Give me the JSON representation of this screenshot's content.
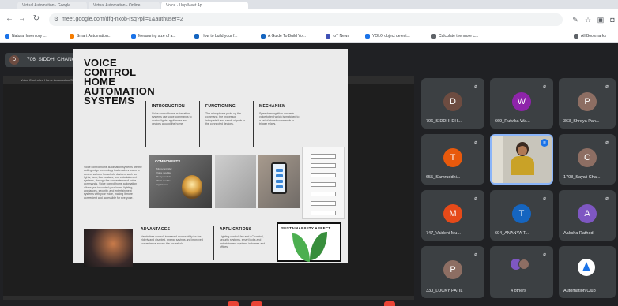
{
  "browser": {
    "tabs": [
      "Virtual Automation · Google...",
      "Virtual Automation - Online...",
      "Voice · Unp Meet Ap"
    ],
    "url": "meet.google.com/dfq-nxob-rsq?pli=1&authuser=2",
    "bookmarks": [
      {
        "label": "Natural Inventory ...",
        "color": "#1a73e8"
      },
      {
        "label": "Smart Automation...",
        "color": "#f57c00"
      },
      {
        "label": "Measuring size of a...",
        "color": "#1a73e8"
      },
      {
        "label": "How to build your f...",
        "color": "#1565c0"
      },
      {
        "label": "A Guide To Build Yo...",
        "color": "#1565c0"
      },
      {
        "label": "IoT News",
        "color": "#3f51b5"
      },
      {
        "label": "YOLO object detect...",
        "color": "#1a73e8"
      },
      {
        "label": "Calculate the more c...",
        "color": "#5f6368"
      },
      {
        "label": "All Bookmarks",
        "color": "#5f6368"
      }
    ]
  },
  "meet": {
    "presenter_initial": "D",
    "presenter_label": "706_SIDDHI CHANCHERE (Presenting)",
    "stage_title": "Voice Controlled Home Automation System · Poster Presentation",
    "participants": [
      {
        "name": "706_SIDDHI DH...",
        "initial": "D",
        "color": "#6d4c41"
      },
      {
        "name": "669_Rutvika Wa...",
        "initial": "W",
        "color": "#8e24aa"
      },
      {
        "name": "363_Shreya Pan...",
        "initial": "P",
        "color": "#8d6e63"
      },
      {
        "name": "655_Samruddhi...",
        "initial": "T",
        "color": "#e8590c"
      },
      {
        "name": "",
        "initial": "",
        "color": ""
      },
      {
        "name": "1708_Sayali Cha...",
        "initial": "C",
        "color": "#8d6e63"
      },
      {
        "name": "747_Vaidehi Mu...",
        "initial": "M",
        "color": "#e64a19"
      },
      {
        "name": "604_ANANYA T...",
        "initial": "T",
        "color": "#1565c0"
      },
      {
        "name": "Aaksha Rathod",
        "initial": "A",
        "color": "#7e57c2"
      },
      {
        "name": "330_LUCKY PATIL",
        "initial": "P",
        "color": "#8d6e63"
      },
      {
        "name": "4 others",
        "initial": "",
        "color": ""
      },
      {
        "name": "Automation Club",
        "initial": "",
        "color": ""
      }
    ]
  },
  "poster": {
    "title": "VOICE CONTROL HOME AUTOMATION SYSTEMS",
    "intro_heading": "INTRODUCTION",
    "functioning_heading": "FUNCTIONING",
    "mechanism_heading": "MECHANISM",
    "components_heading": "COMPONENTS",
    "advantages_heading": "ADVANTAGES",
    "applications_heading": "APPLICATIONS",
    "sustainability_heading": "SUSTAINABILITY ASPECT",
    "intro_text": "Voice control home automation systems use voice commands to control lights, appliances and devices around the home.",
    "functioning_text": "The microphone picks up the command, the processor interprets it and sends signals to the connected devices.",
    "mechanism_text": "Speech recognition converts voice to text which is matched to a set of stored commands to trigger relays.",
    "lead_text": "Voice control home automation systems are the cutting-edge technology that enables users to control various household devices, such as lights, fans, thermostats, and entertainment systems, through the convenience of voice commands. Voice control home automation allows you to control your home lighting, appliances, security, and entertainment systems with your voice, making it more convenient and accessible for everyone.",
    "components_list": [
      "Microcontroller",
      "Voice module",
      "Relay module",
      "Wi-Fi module",
      "Appliances"
    ],
    "advantages_text": "Hands-free control, increased accessibility for the elderly and disabled, energy savings and improved convenience across the household.",
    "applications_text": "Lighting control, fan and AC control, security systems, smart locks and entertainment systems in homes and offices."
  }
}
